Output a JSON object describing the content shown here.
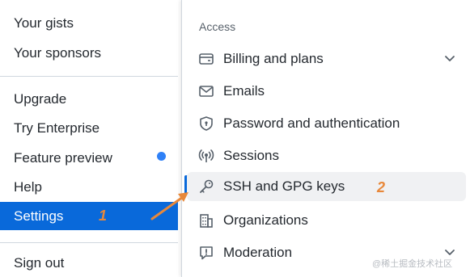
{
  "left_menu": {
    "items": [
      {
        "label": "Your gists"
      },
      {
        "label": "Your sponsors"
      },
      {
        "label": "Upgrade"
      },
      {
        "label": "Try Enterprise"
      },
      {
        "label": "Feature preview"
      },
      {
        "label": "Help"
      },
      {
        "label": "Settings"
      },
      {
        "label": "Sign out"
      }
    ],
    "step_marker": "1",
    "selected_color": "#0969da",
    "indicator_color": "#2f81f7"
  },
  "settings_menu": {
    "section_heading": "Access",
    "items": [
      {
        "label": "Billing and plans",
        "icon": "credit-card-icon"
      },
      {
        "label": "Emails",
        "icon": "mail-icon"
      },
      {
        "label": "Password and authentication",
        "icon": "shield-lock-icon"
      },
      {
        "label": "Sessions",
        "icon": "broadcast-icon"
      },
      {
        "label": "SSH and GPG keys",
        "icon": "key-icon"
      },
      {
        "label": "Organizations",
        "icon": "organization-icon"
      },
      {
        "label": "Moderation",
        "icon": "report-icon"
      }
    ],
    "step_marker": "2",
    "annotation_color": "#e8883a"
  },
  "watermark": "@稀土掘金技术社区"
}
